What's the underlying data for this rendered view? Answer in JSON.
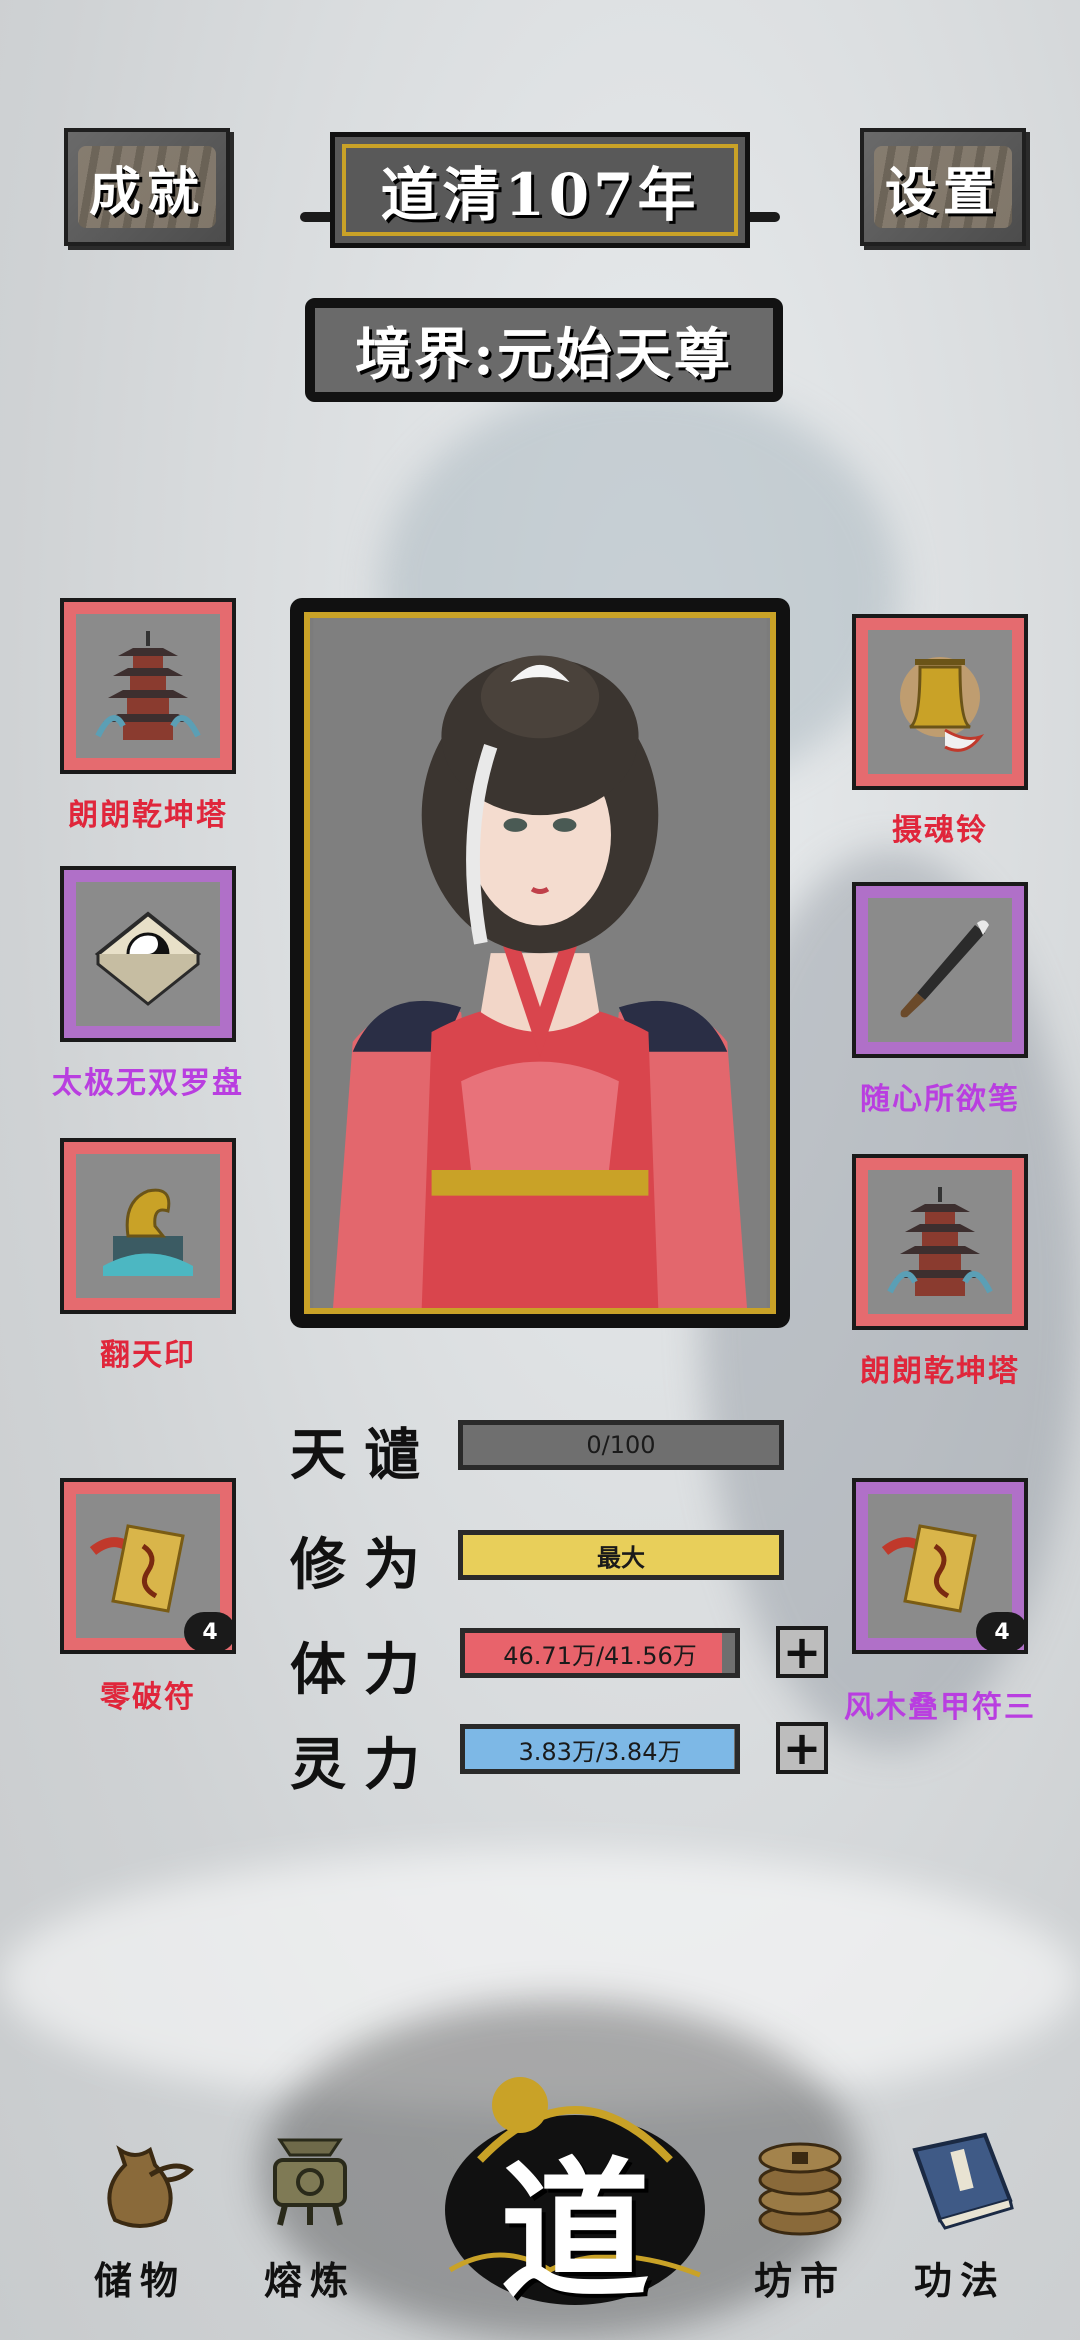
{
  "header": {
    "achievements_label": "成就",
    "year_label": "道清107年",
    "settings_label": "设置",
    "realm_label": "境界:元始天尊"
  },
  "equipment": {
    "left": [
      {
        "name": "朗朗乾坤塔",
        "rarity": "red",
        "icon": "pagoda-icon"
      },
      {
        "name": "太极无双罗盘",
        "rarity": "purple",
        "icon": "compass-icon"
      },
      {
        "name": "翻天印",
        "rarity": "red",
        "icon": "seal-icon"
      },
      {
        "name": "零破符",
        "rarity": "red",
        "icon": "talisman-icon",
        "count": "4"
      }
    ],
    "right": [
      {
        "name": "摄魂铃",
        "rarity": "red",
        "icon": "bell-icon"
      },
      {
        "name": "随心所欲笔",
        "rarity": "purple",
        "icon": "brush-icon"
      },
      {
        "name": "朗朗乾坤塔",
        "rarity": "red",
        "icon": "pagoda-icon"
      },
      {
        "name": "风木叠甲符三",
        "rarity": "purple",
        "icon": "talisman-icon",
        "count": "4"
      }
    ]
  },
  "stats": {
    "tribulation": {
      "label": "天谴",
      "text": "0/100",
      "fraction": 0.0
    },
    "cultivation": {
      "label": "修为",
      "text": "最大",
      "fraction": 1.0
    },
    "stamina": {
      "label": "体力",
      "text": "46.71万/41.56万",
      "fraction": 0.95
    },
    "spirit": {
      "label": "灵力",
      "text": "3.83万/3.84万",
      "fraction": 0.997
    }
  },
  "nav": {
    "storage": "储物",
    "smelt": "熔炼",
    "dao": "道",
    "market": "坊市",
    "skills": "功法"
  },
  "colors": {
    "red_rarity": "#e56b6f",
    "purple_rarity": "#b070c8",
    "gold_frame": "#c9a227",
    "cultivation_bar": "#e8cf5a",
    "stamina_bar": "#e8636b",
    "spirit_bar": "#7db8e6"
  }
}
